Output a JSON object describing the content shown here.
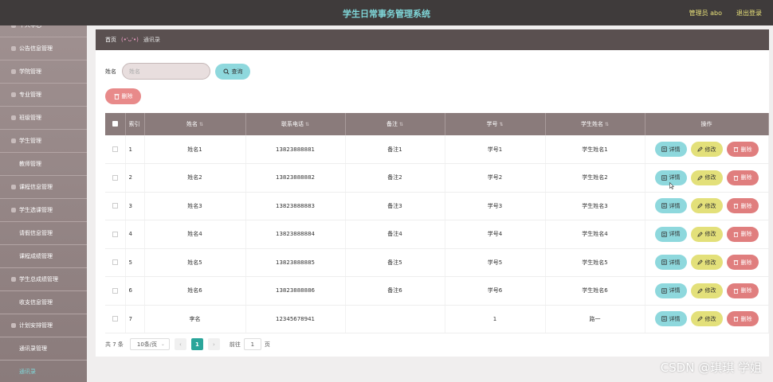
{
  "header": {
    "title": "学生日常事务管理系统",
    "user": "管理员 abo",
    "logout": "退出登录"
  },
  "sidebar": {
    "items": [
      {
        "label": "个人中心",
        "sub": false
      },
      {
        "label": "公告信息管理",
        "sub": false
      },
      {
        "label": "学院管理",
        "sub": false
      },
      {
        "label": "专业管理",
        "sub": false
      },
      {
        "label": "班级管理",
        "sub": false
      },
      {
        "label": "学生管理",
        "sub": false
      },
      {
        "label": "教师管理",
        "sub": true
      },
      {
        "label": "课程信息管理",
        "sub": false
      },
      {
        "label": "学生选课管理",
        "sub": false
      },
      {
        "label": "请假信息管理",
        "sub": true
      },
      {
        "label": "课程成绩管理",
        "sub": true
      },
      {
        "label": "学生总成绩管理",
        "sub": false
      },
      {
        "label": "收支信息管理",
        "sub": true
      },
      {
        "label": "计划安排管理",
        "sub": false
      },
      {
        "label": "通讯录管理",
        "sub": true
      },
      {
        "label": "通讯录",
        "sub": true,
        "active": true
      }
    ]
  },
  "breadcrumb": {
    "home": "首页",
    "deco": "(•'ᴗ'•)",
    "current": "通讯录"
  },
  "search": {
    "label": "姓名",
    "placeholder": "姓名",
    "button": "查询"
  },
  "toolbar": {
    "delete": "删除"
  },
  "table": {
    "columns": [
      "索引",
      "姓名",
      "联系电话",
      "备注",
      "学号",
      "学生姓名",
      "操作"
    ],
    "rows": [
      {
        "idx": "1",
        "name": "姓名1",
        "phone": "13823888881",
        "note": "备注1",
        "sid": "学号1",
        "sname": "学生姓名1"
      },
      {
        "idx": "2",
        "name": "姓名2",
        "phone": "13823888882",
        "note": "备注2",
        "sid": "学号2",
        "sname": "学生姓名2"
      },
      {
        "idx": "3",
        "name": "姓名3",
        "phone": "13823888883",
        "note": "备注3",
        "sid": "学号3",
        "sname": "学生姓名3"
      },
      {
        "idx": "4",
        "name": "姓名4",
        "phone": "13823888884",
        "note": "备注4",
        "sid": "学号4",
        "sname": "学生姓名4"
      },
      {
        "idx": "5",
        "name": "姓名5",
        "phone": "13823888885",
        "note": "备注5",
        "sid": "学号5",
        "sname": "学生姓名5"
      },
      {
        "idx": "6",
        "name": "姓名6",
        "phone": "13823888886",
        "note": "备注6",
        "sid": "学号6",
        "sname": "学生姓名6"
      },
      {
        "idx": "7",
        "name": "李名",
        "phone": "12345678941",
        "note": "",
        "sid": "1",
        "sname": "路一"
      }
    ],
    "actions": {
      "detail": "详情",
      "edit": "修改",
      "delete": "删除"
    }
  },
  "pager": {
    "total": "共 7 条",
    "page_size": "10条/页",
    "current_page": "1",
    "goto_label": "前往",
    "goto_value": "1",
    "page_unit": "页"
  },
  "watermark": "CSDN @琪琪 学姐",
  "colors": {
    "topbar": "#3f3b3b",
    "sidebar": "#8a7b7b",
    "accent_cyan": "#8ed8dd",
    "accent_yellow": "#e3e07a",
    "accent_red": "#e07e7e",
    "pager_active": "#2aa59a"
  }
}
